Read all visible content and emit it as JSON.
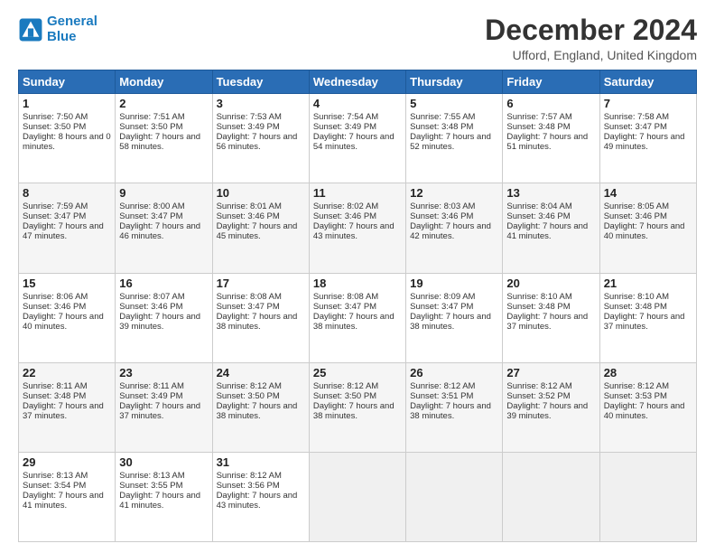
{
  "logo": {
    "line1": "General",
    "line2": "Blue"
  },
  "header": {
    "title": "December 2024",
    "subtitle": "Ufford, England, United Kingdom"
  },
  "weekdays": [
    "Sunday",
    "Monday",
    "Tuesday",
    "Wednesday",
    "Thursday",
    "Friday",
    "Saturday"
  ],
  "weeks": [
    [
      {
        "day": "1",
        "sunrise": "7:50 AM",
        "sunset": "3:50 PM",
        "daylight": "8 hours and 0 minutes."
      },
      {
        "day": "2",
        "sunrise": "7:51 AM",
        "sunset": "3:50 PM",
        "daylight": "7 hours and 58 minutes."
      },
      {
        "day": "3",
        "sunrise": "7:53 AM",
        "sunset": "3:49 PM",
        "daylight": "7 hours and 56 minutes."
      },
      {
        "day": "4",
        "sunrise": "7:54 AM",
        "sunset": "3:49 PM",
        "daylight": "7 hours and 54 minutes."
      },
      {
        "day": "5",
        "sunrise": "7:55 AM",
        "sunset": "3:48 PM",
        "daylight": "7 hours and 52 minutes."
      },
      {
        "day": "6",
        "sunrise": "7:57 AM",
        "sunset": "3:48 PM",
        "daylight": "7 hours and 51 minutes."
      },
      {
        "day": "7",
        "sunrise": "7:58 AM",
        "sunset": "3:47 PM",
        "daylight": "7 hours and 49 minutes."
      }
    ],
    [
      {
        "day": "8",
        "sunrise": "7:59 AM",
        "sunset": "3:47 PM",
        "daylight": "7 hours and 47 minutes."
      },
      {
        "day": "9",
        "sunrise": "8:00 AM",
        "sunset": "3:47 PM",
        "daylight": "7 hours and 46 minutes."
      },
      {
        "day": "10",
        "sunrise": "8:01 AM",
        "sunset": "3:46 PM",
        "daylight": "7 hours and 45 minutes."
      },
      {
        "day": "11",
        "sunrise": "8:02 AM",
        "sunset": "3:46 PM",
        "daylight": "7 hours and 43 minutes."
      },
      {
        "day": "12",
        "sunrise": "8:03 AM",
        "sunset": "3:46 PM",
        "daylight": "7 hours and 42 minutes."
      },
      {
        "day": "13",
        "sunrise": "8:04 AM",
        "sunset": "3:46 PM",
        "daylight": "7 hours and 41 minutes."
      },
      {
        "day": "14",
        "sunrise": "8:05 AM",
        "sunset": "3:46 PM",
        "daylight": "7 hours and 40 minutes."
      }
    ],
    [
      {
        "day": "15",
        "sunrise": "8:06 AM",
        "sunset": "3:46 PM",
        "daylight": "7 hours and 40 minutes."
      },
      {
        "day": "16",
        "sunrise": "8:07 AM",
        "sunset": "3:46 PM",
        "daylight": "7 hours and 39 minutes."
      },
      {
        "day": "17",
        "sunrise": "8:08 AM",
        "sunset": "3:47 PM",
        "daylight": "7 hours and 38 minutes."
      },
      {
        "day": "18",
        "sunrise": "8:08 AM",
        "sunset": "3:47 PM",
        "daylight": "7 hours and 38 minutes."
      },
      {
        "day": "19",
        "sunrise": "8:09 AM",
        "sunset": "3:47 PM",
        "daylight": "7 hours and 38 minutes."
      },
      {
        "day": "20",
        "sunrise": "8:10 AM",
        "sunset": "3:48 PM",
        "daylight": "7 hours and 37 minutes."
      },
      {
        "day": "21",
        "sunrise": "8:10 AM",
        "sunset": "3:48 PM",
        "daylight": "7 hours and 37 minutes."
      }
    ],
    [
      {
        "day": "22",
        "sunrise": "8:11 AM",
        "sunset": "3:48 PM",
        "daylight": "7 hours and 37 minutes."
      },
      {
        "day": "23",
        "sunrise": "8:11 AM",
        "sunset": "3:49 PM",
        "daylight": "7 hours and 37 minutes."
      },
      {
        "day": "24",
        "sunrise": "8:12 AM",
        "sunset": "3:50 PM",
        "daylight": "7 hours and 38 minutes."
      },
      {
        "day": "25",
        "sunrise": "8:12 AM",
        "sunset": "3:50 PM",
        "daylight": "7 hours and 38 minutes."
      },
      {
        "day": "26",
        "sunrise": "8:12 AM",
        "sunset": "3:51 PM",
        "daylight": "7 hours and 38 minutes."
      },
      {
        "day": "27",
        "sunrise": "8:12 AM",
        "sunset": "3:52 PM",
        "daylight": "7 hours and 39 minutes."
      },
      {
        "day": "28",
        "sunrise": "8:12 AM",
        "sunset": "3:53 PM",
        "daylight": "7 hours and 40 minutes."
      }
    ],
    [
      {
        "day": "29",
        "sunrise": "8:13 AM",
        "sunset": "3:54 PM",
        "daylight": "7 hours and 41 minutes."
      },
      {
        "day": "30",
        "sunrise": "8:13 AM",
        "sunset": "3:55 PM",
        "daylight": "7 hours and 41 minutes."
      },
      {
        "day": "31",
        "sunrise": "8:12 AM",
        "sunset": "3:56 PM",
        "daylight": "7 hours and 43 minutes."
      },
      null,
      null,
      null,
      null
    ]
  ]
}
